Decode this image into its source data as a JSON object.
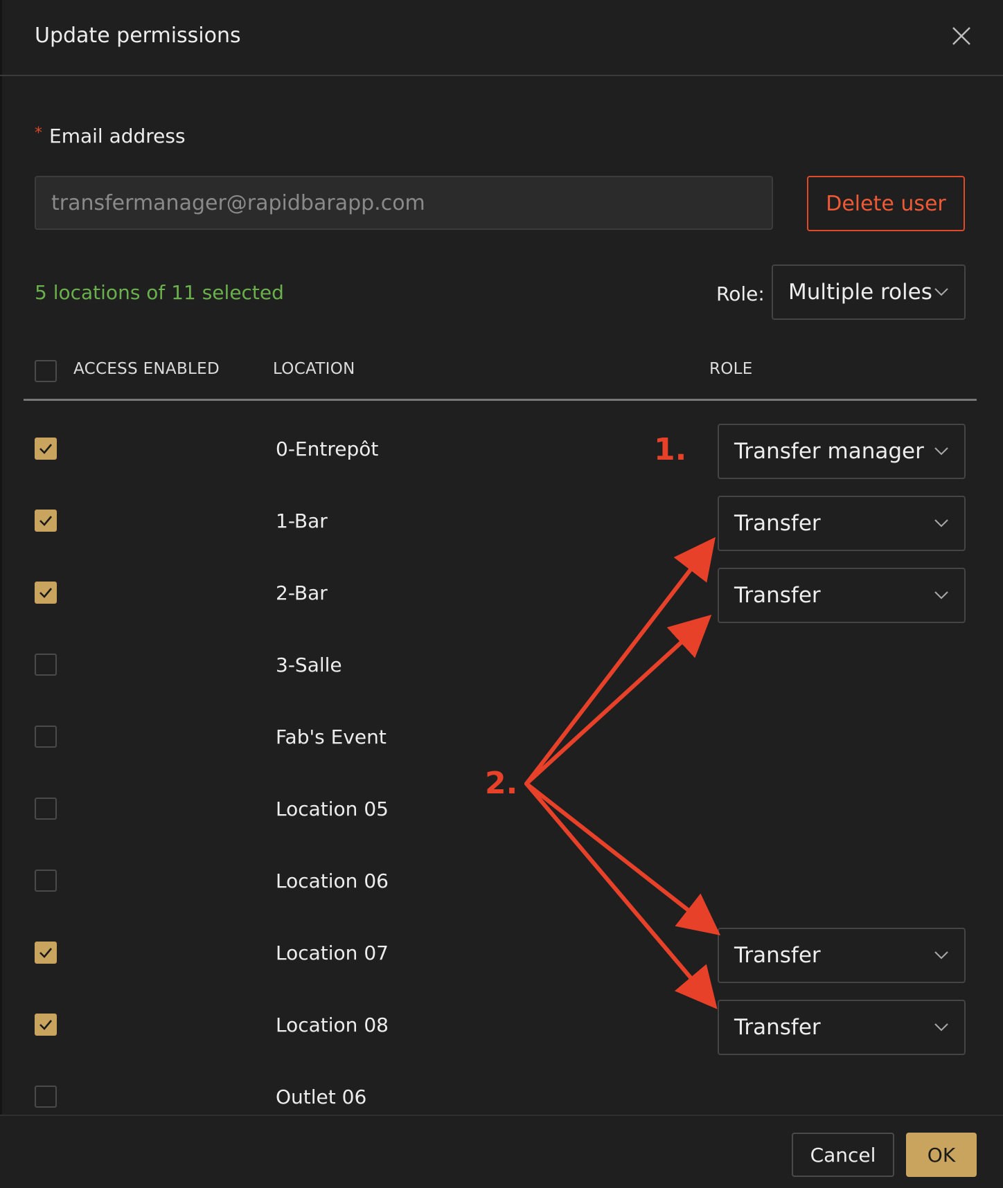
{
  "dialog": {
    "title": "Update permissions"
  },
  "email": {
    "required_mark": "*",
    "label": "Email address",
    "value": "transfermanager@rapidbarapp.com"
  },
  "delete_button": "Delete user",
  "selection_summary": "5 locations of 11 selected",
  "role_filter": {
    "label": "Role:",
    "value": "Multiple roles"
  },
  "table": {
    "headers": {
      "access": "ACCESS ENABLED",
      "location": "LOCATION",
      "role": "ROLE"
    },
    "rows": [
      {
        "location": "0-Entrepôt",
        "enabled": true,
        "role": "Transfer manager"
      },
      {
        "location": "1-Bar",
        "enabled": true,
        "role": "Transfer"
      },
      {
        "location": "2-Bar",
        "enabled": true,
        "role": "Transfer"
      },
      {
        "location": "3-Salle",
        "enabled": false,
        "role": ""
      },
      {
        "location": "Fab's Event",
        "enabled": false,
        "role": ""
      },
      {
        "location": "Location 05",
        "enabled": false,
        "role": ""
      },
      {
        "location": "Location 06",
        "enabled": false,
        "role": ""
      },
      {
        "location": "Location 07",
        "enabled": true,
        "role": "Transfer"
      },
      {
        "location": "Location 08",
        "enabled": true,
        "role": "Transfer"
      },
      {
        "location": "Outlet 06",
        "enabled": false,
        "role": ""
      }
    ]
  },
  "footer": {
    "cancel": "Cancel",
    "ok": "OK"
  },
  "annotations": {
    "label_1": "1.",
    "label_2": "2.",
    "color": "#e8412a"
  },
  "colors": {
    "accent_gold": "#c9a45e",
    "danger": "#e0492a",
    "success_text": "#6ab04c",
    "background": "#1f1f1f"
  }
}
